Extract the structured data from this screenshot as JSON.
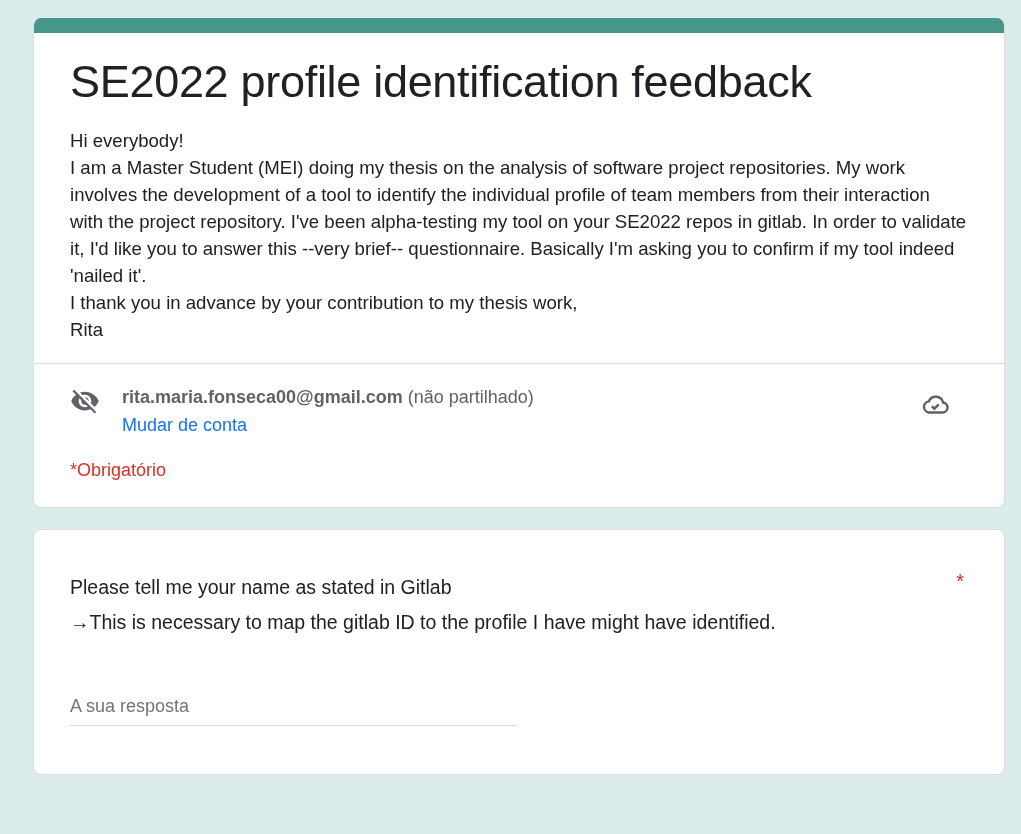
{
  "form": {
    "title": "SE2022 profile identification feedback",
    "description": [
      "Hi everybody!",
      "I am a Master Student (MEI) doing my thesis on the analysis of software project repositories. My work involves the development of a tool to identify the individual profile of team members from their interaction with the project repository. I've been alpha-testing my tool on your SE2022 repos in gitlab. In order to validate it, I'd like you to answer this --very brief-- questionnaire. Basically I'm asking you to confirm if my tool indeed 'nailed it'.",
      "I thank you in advance by your contribution to my thesis work,",
      "Rita"
    ],
    "account": {
      "email": "rita.maria.fonseca00@gmail.com",
      "note": "(não partilhado)",
      "switch_link": "Mudar de conta"
    },
    "required_note": "*Obrigatório"
  },
  "questions": [
    {
      "title": "Please tell me your name as stated in Gitlab",
      "description": "→This is necessary to map the gitlab ID to the profile I have might have identified.",
      "required": true,
      "required_mark": "*",
      "placeholder": "A sua resposta"
    }
  ]
}
